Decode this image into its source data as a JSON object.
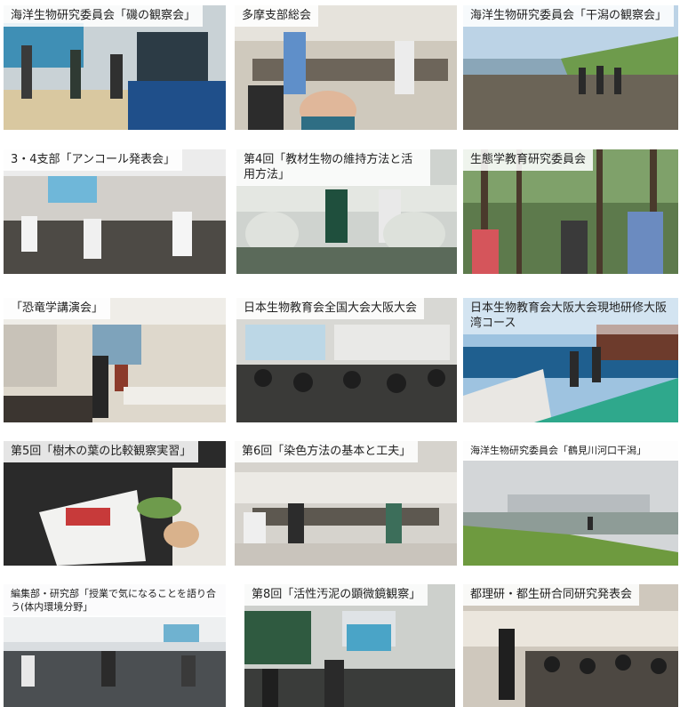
{
  "tiles": [
    {
      "caption": "海洋生物研究委員会「磯の観察会」"
    },
    {
      "caption": "多摩支部総会"
    },
    {
      "caption": "海洋生物研究委員会「干潟の観察会」"
    },
    {
      "caption": "3・4支部「アンコール発表会」"
    },
    {
      "caption": "第4回「教材生物の維持方法と活用方法」"
    },
    {
      "caption": "生態学教育研究委員会"
    },
    {
      "caption": "「恐竜学講演会」"
    },
    {
      "caption": "日本生物教育会全国大会大阪大会"
    },
    {
      "caption": "日本生物教育会大阪大会現地研修大阪湾コース"
    },
    {
      "caption": "第5回「樹木の葉の比較観察実習」"
    },
    {
      "caption": "第6回「染色方法の基本と工夫」"
    },
    {
      "caption": "海洋生物研究委員会「鶴見川河口干潟」"
    },
    {
      "caption": "編集部・研究部「授業で気になることを語り合う(体内環境分野」"
    },
    {
      "caption": "第8回「活性汚泥の顕微鏡観察」"
    },
    {
      "caption": "都理研・都生研合同研究発表会"
    }
  ]
}
